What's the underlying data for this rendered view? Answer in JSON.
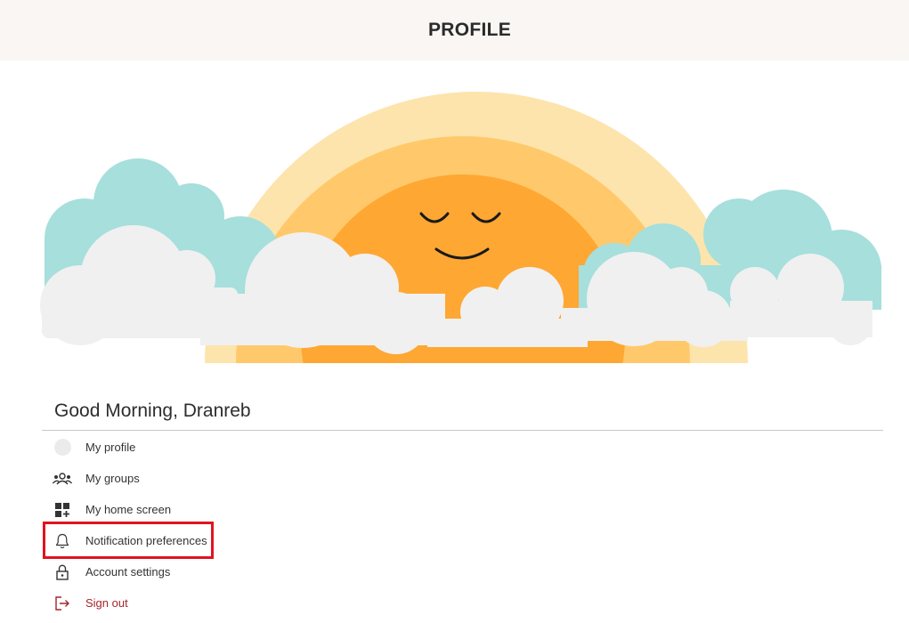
{
  "header": {
    "title": "PROFILE"
  },
  "greeting": "Good Morning, Dranreb",
  "menu": {
    "items": [
      {
        "label": "My profile",
        "icon": "avatar-icon"
      },
      {
        "label": "My groups",
        "icon": "people-icon"
      },
      {
        "label": "My home screen",
        "icon": "add-grid-icon"
      },
      {
        "label": "Notification preferences",
        "icon": "bell-icon"
      },
      {
        "label": "Account settings",
        "icon": "lock-icon"
      },
      {
        "label": "Sign out",
        "icon": "sign-out-icon"
      }
    ]
  },
  "colors": {
    "header_bg": "#f9f6f3",
    "sun": "#ffa733",
    "rainbow_outer": "#fde4ad",
    "rainbow_inner": "#ffc96b",
    "cloud_teal": "#a6dfdc",
    "cloud_grey": "#f0f0f0",
    "sign_out_text": "#a4262c",
    "highlight": "#e0141e"
  }
}
